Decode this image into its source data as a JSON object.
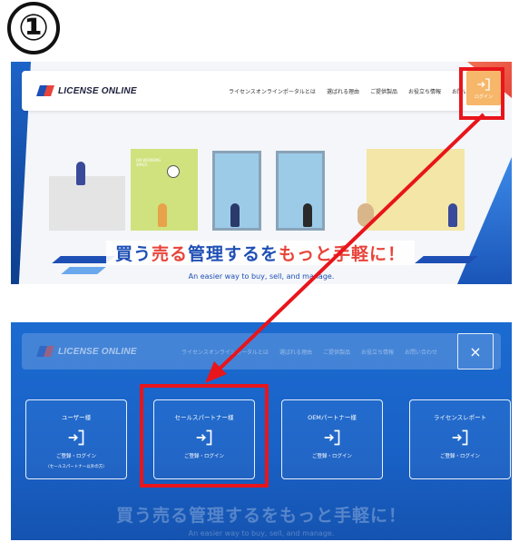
{
  "step_number": "①",
  "site": {
    "logo_text": "LICENSE ONLINE",
    "nav_links": [
      "ライセンスオンラインポータルとは",
      "選ばれる理由",
      "ご提供製品",
      "お役立ち情報",
      "お問い合わせ"
    ],
    "login_label": "ログイン",
    "scene_sign": "ON WORKING SPACE",
    "catchphrase_parts": [
      "買う",
      "売る",
      "管理する",
      "を",
      "もっと手軽に！"
    ],
    "tagline": "An easier way to buy, sell, and manage."
  },
  "modal": {
    "cards": [
      {
        "title": "ユーザー様",
        "action": "ご登録・ログイン",
        "note": "（セールスパートナー以外の方）"
      },
      {
        "title": "セールスパートナー様",
        "action": "ご登録・ログイン",
        "note": ""
      },
      {
        "title": "OEMパートナー様",
        "action": "ご登録・ログイン",
        "note": ""
      },
      {
        "title": "ライセンスレポート",
        "action": "ご登録・ログイン",
        "note": ""
      }
    ],
    "close_symbol": "×"
  },
  "colors": {
    "highlight": "#e8151b",
    "brand_blue": "#1e4fb5",
    "brand_red": "#e8443a",
    "login_orange": "#f6b76a",
    "overlay_blue": "#1b6bd1"
  },
  "icons": [
    "login-icon",
    "close-icon",
    "arrow-icon"
  ]
}
